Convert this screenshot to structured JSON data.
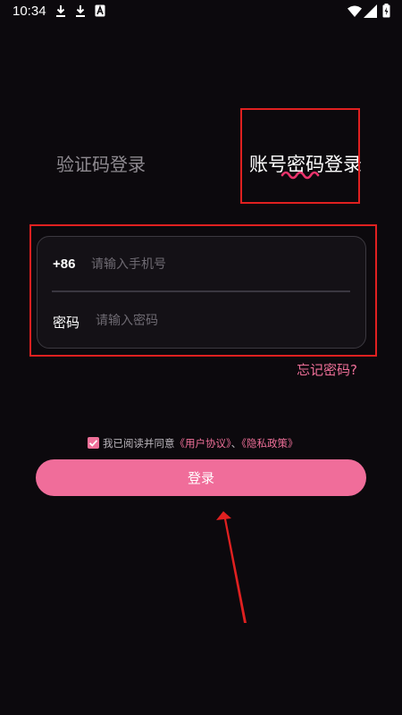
{
  "status_bar": {
    "time": "10:34",
    "icons": [
      "download-icon",
      "download-icon",
      "a-icon",
      "wifi-icon",
      "signal-icon",
      "battery-charging-icon"
    ]
  },
  "tabs": [
    {
      "label": "验证码登录",
      "active": false
    },
    {
      "label": "账号密码登录",
      "active": true
    }
  ],
  "form": {
    "country_code": "+86",
    "phone_placeholder": "请输入手机号",
    "phone_value": "",
    "password_label": "密码",
    "password_placeholder": "请输入密码",
    "password_value": ""
  },
  "forgot_password": "忘记密码?",
  "agreement": {
    "checked": true,
    "prefix": "我已阅读并同意",
    "user_agreement": "《用户协议》",
    "separator": "、",
    "privacy_policy": "《隐私政策》"
  },
  "login_button": "登录",
  "colors": {
    "background": "#0c090d",
    "accent": "#f06d9a",
    "annotation": "#e02020"
  }
}
